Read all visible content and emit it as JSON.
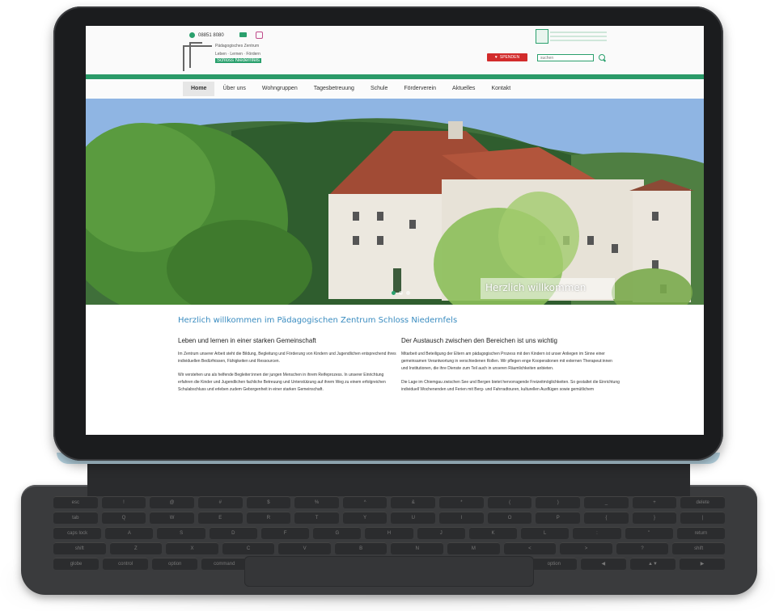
{
  "site": {
    "phone": "08851 8080",
    "logo": {
      "line1": "Pädagogisches Zentrum",
      "line2": "Leben · Lernen · Fördern",
      "line3": "Schloss Niedernfels"
    },
    "donate_label": "SPENDEN",
    "search_placeholder": "suchen"
  },
  "nav": {
    "items": [
      "Home",
      "Über uns",
      "Wohngruppen",
      "Tagesbetreuung",
      "Schule",
      "Förderverein",
      "Aktuelles",
      "Kontakt"
    ]
  },
  "hero": {
    "caption": "Herzlich willkommen"
  },
  "content": {
    "title": "Herzlich willkommen im Pädagogischen Zentrum Schloss Niedernfels",
    "left": {
      "heading": "Leben und lernen in einer starken Gemeinschaft",
      "p1": "Im Zentrum unserer Arbeit steht die Bildung, Begleitung und Förderung von Kindern und Jugendlichen entsprechend ihres individuellen Bedürfnissen, Fähigkeiten und Ressourcen.",
      "p2": "Wir verstehen uns als helfende Begleiter:innen der jungen Menschen in ihrem Reifeprozess. In unserer Einrichtung erfahren die Kinder und Jugendlichen fachliche Betreuung und Unterstützung auf ihrem Weg zu einem erfolgreichen Schulabschluss und erleben zudem Geborgenheit in einer starken Gemeinschaft."
    },
    "right": {
      "heading": "Der Austausch zwischen den Bereichen ist uns wichtig",
      "p1": "Mitarbeit und Beteiligung der Eltern am pädagogischen Prozess mit den Kindern ist unser Anliegen im Sinne einer gemeinsamen Verantwortung in verschiedenen Rollen. Wir pflegen enge Kooperationen mit externen Therapeut:innen und Institutionen, die ihre Dienste zum Teil auch in unseren Räumlichkeiten anbieten.",
      "p2": "Die Lage im Chiemgau zwischen See und Bergen bietet hervorragende Freizeitmöglichkeiten. So gestaltet die Einrichtung individuell Wochenenden und Ferien mit Berg- und Fahrradtouren, kulturellen Ausflügen sowie gemütlichem"
    }
  },
  "keyboard": {
    "row1": [
      "esc",
      "!",
      "@",
      "#",
      "$",
      "%",
      "^",
      "&",
      "*",
      "(",
      ")",
      "_",
      "+",
      "delete"
    ],
    "row2": [
      "tab",
      "Q",
      "W",
      "E",
      "R",
      "T",
      "Y",
      "U",
      "I",
      "O",
      "P",
      "{",
      "}",
      "|"
    ],
    "row3": [
      "caps lock",
      "A",
      "S",
      "D",
      "F",
      "G",
      "H",
      "J",
      "K",
      "L",
      ":",
      "\"",
      "return"
    ],
    "row4": [
      "shift",
      "Z",
      "X",
      "C",
      "V",
      "B",
      "N",
      "M",
      "<",
      ">",
      "?",
      "shift"
    ],
    "row5": [
      "globe",
      "control",
      "option",
      "command",
      "",
      "command",
      "option",
      "◀",
      "▲▼",
      "▶"
    ]
  }
}
